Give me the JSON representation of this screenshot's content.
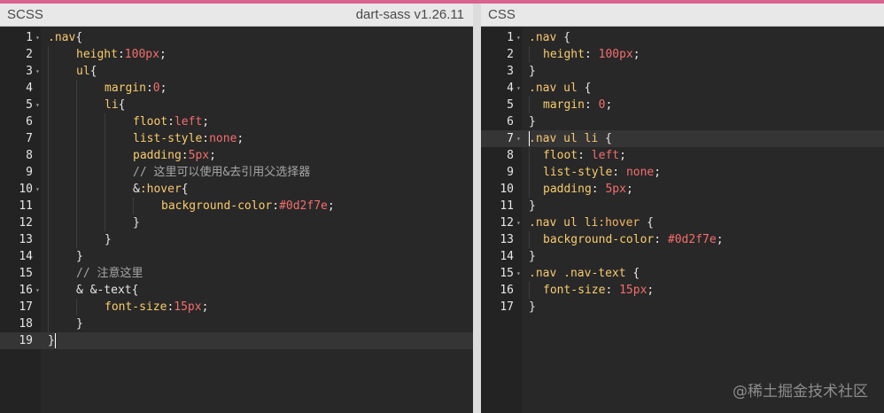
{
  "left_pane": {
    "language": "SCSS",
    "compiler_version": "dart-sass v1.26.11",
    "active_line": 19,
    "lines": [
      {
        "n": "1",
        "fold": true,
        "indent": 0,
        "tokens": [
          [
            ".nav",
            "sel"
          ],
          [
            "{",
            "pun"
          ]
        ]
      },
      {
        "n": "2",
        "fold": false,
        "indent": 1,
        "tokens": [
          [
            "height",
            "prop"
          ],
          [
            ":",
            "pun"
          ],
          [
            "100px",
            "num"
          ],
          [
            ";",
            "pun"
          ]
        ]
      },
      {
        "n": "3",
        "fold": true,
        "indent": 1,
        "tokens": [
          [
            "ul",
            "sel"
          ],
          [
            "{",
            "pun"
          ]
        ]
      },
      {
        "n": "4",
        "fold": false,
        "indent": 2,
        "tokens": [
          [
            "margin",
            "prop"
          ],
          [
            ":",
            "pun"
          ],
          [
            "0",
            "num"
          ],
          [
            ";",
            "pun"
          ]
        ]
      },
      {
        "n": "5",
        "fold": true,
        "indent": 2,
        "tokens": [
          [
            "li",
            "sel"
          ],
          [
            "{",
            "pun"
          ]
        ]
      },
      {
        "n": "6",
        "fold": false,
        "indent": 3,
        "tokens": [
          [
            "floot",
            "prop"
          ],
          [
            ":",
            "pun"
          ],
          [
            "left",
            "val"
          ],
          [
            ";",
            "pun"
          ]
        ]
      },
      {
        "n": "7",
        "fold": false,
        "indent": 3,
        "tokens": [
          [
            "list-style",
            "prop"
          ],
          [
            ":",
            "pun"
          ],
          [
            "none",
            "val"
          ],
          [
            ";",
            "pun"
          ]
        ]
      },
      {
        "n": "8",
        "fold": false,
        "indent": 3,
        "tokens": [
          [
            "padding",
            "prop"
          ],
          [
            ":",
            "pun"
          ],
          [
            "5px",
            "num"
          ],
          [
            ";",
            "pun"
          ]
        ]
      },
      {
        "n": "9",
        "fold": false,
        "indent": 3,
        "tokens": [
          [
            "// 这里可以使用&去引用父选择器",
            "com"
          ]
        ]
      },
      {
        "n": "10",
        "fold": true,
        "indent": 3,
        "tokens": [
          [
            "&",
            "pun"
          ],
          [
            ":hover",
            "sel"
          ],
          [
            "{",
            "pun"
          ]
        ]
      },
      {
        "n": "11",
        "fold": false,
        "indent": 4,
        "tokens": [
          [
            "background-color",
            "prop"
          ],
          [
            ":",
            "pun"
          ],
          [
            "#0d2f7e",
            "num"
          ],
          [
            ";",
            "pun"
          ]
        ]
      },
      {
        "n": "12",
        "fold": false,
        "indent": 3,
        "tokens": [
          [
            "}",
            "pun"
          ]
        ]
      },
      {
        "n": "13",
        "fold": false,
        "indent": 2,
        "tokens": [
          [
            "}",
            "pun"
          ]
        ]
      },
      {
        "n": "14",
        "fold": false,
        "indent": 1,
        "tokens": [
          [
            "}",
            "pun"
          ]
        ]
      },
      {
        "n": "15",
        "fold": false,
        "indent": 1,
        "tokens": [
          [
            "// 注意这里",
            "com"
          ]
        ]
      },
      {
        "n": "16",
        "fold": true,
        "indent": 1,
        "tokens": [
          [
            "& &-text{",
            "pun"
          ]
        ]
      },
      {
        "n": "17",
        "fold": false,
        "indent": 2,
        "tokens": [
          [
            "font-size",
            "prop"
          ],
          [
            ":",
            "pun"
          ],
          [
            "15px",
            "num"
          ],
          [
            ";",
            "pun"
          ]
        ]
      },
      {
        "n": "18",
        "fold": false,
        "indent": 1,
        "tokens": [
          [
            "}",
            "pun"
          ]
        ]
      },
      {
        "n": "19",
        "fold": false,
        "indent": 0,
        "tokens": [
          [
            "}",
            "pun"
          ]
        ]
      }
    ]
  },
  "right_pane": {
    "language": "CSS",
    "active_line": 7,
    "lines": [
      {
        "n": "1",
        "fold": true,
        "indent": 0,
        "tokens": [
          [
            ".nav",
            "sel"
          ],
          [
            " {",
            "pun"
          ]
        ]
      },
      {
        "n": "2",
        "fold": false,
        "indent": 1,
        "tokens": [
          [
            "height",
            "prop"
          ],
          [
            ": ",
            "pun"
          ],
          [
            "100px",
            "num"
          ],
          [
            ";",
            "pun"
          ]
        ]
      },
      {
        "n": "3",
        "fold": false,
        "indent": 0,
        "tokens": [
          [
            "}",
            "pun"
          ]
        ]
      },
      {
        "n": "4",
        "fold": true,
        "indent": 0,
        "tokens": [
          [
            ".nav ul",
            "sel"
          ],
          [
            " {",
            "pun"
          ]
        ]
      },
      {
        "n": "5",
        "fold": false,
        "indent": 1,
        "tokens": [
          [
            "margin",
            "prop"
          ],
          [
            ": ",
            "pun"
          ],
          [
            "0",
            "num"
          ],
          [
            ";",
            "pun"
          ]
        ]
      },
      {
        "n": "6",
        "fold": false,
        "indent": 0,
        "tokens": [
          [
            "}",
            "pun"
          ]
        ]
      },
      {
        "n": "7",
        "fold": true,
        "indent": 0,
        "tokens": [
          [
            ".nav ul li",
            "sel"
          ],
          [
            " {",
            "pun"
          ]
        ]
      },
      {
        "n": "8",
        "fold": false,
        "indent": 1,
        "tokens": [
          [
            "floot",
            "prop"
          ],
          [
            ": ",
            "pun"
          ],
          [
            "left",
            "val"
          ],
          [
            ";",
            "pun"
          ]
        ]
      },
      {
        "n": "9",
        "fold": false,
        "indent": 1,
        "tokens": [
          [
            "list-style",
            "prop"
          ],
          [
            ": ",
            "pun"
          ],
          [
            "none",
            "val"
          ],
          [
            ";",
            "pun"
          ]
        ]
      },
      {
        "n": "10",
        "fold": false,
        "indent": 1,
        "tokens": [
          [
            "padding",
            "prop"
          ],
          [
            ": ",
            "pun"
          ],
          [
            "5px",
            "num"
          ],
          [
            ";",
            "pun"
          ]
        ]
      },
      {
        "n": "11",
        "fold": false,
        "indent": 0,
        "tokens": [
          [
            "}",
            "pun"
          ]
        ]
      },
      {
        "n": "12",
        "fold": true,
        "indent": 0,
        "tokens": [
          [
            ".nav ul li",
            "sel"
          ],
          [
            ":hover",
            "kw"
          ],
          [
            " {",
            "pun"
          ]
        ]
      },
      {
        "n": "13",
        "fold": false,
        "indent": 1,
        "tokens": [
          [
            "background-color",
            "prop"
          ],
          [
            ": ",
            "pun"
          ],
          [
            "#0d2f7e",
            "num"
          ],
          [
            ";",
            "pun"
          ]
        ]
      },
      {
        "n": "14",
        "fold": false,
        "indent": 0,
        "tokens": [
          [
            "}",
            "pun"
          ]
        ]
      },
      {
        "n": "15",
        "fold": true,
        "indent": 0,
        "tokens": [
          [
            ".nav .nav-text",
            "sel"
          ],
          [
            " {",
            "pun"
          ]
        ]
      },
      {
        "n": "16",
        "fold": false,
        "indent": 1,
        "tokens": [
          [
            "font-size",
            "prop"
          ],
          [
            ": ",
            "pun"
          ],
          [
            "15px",
            "num"
          ],
          [
            ";",
            "pun"
          ]
        ]
      },
      {
        "n": "17",
        "fold": false,
        "indent": 0,
        "tokens": [
          [
            "}",
            "pun"
          ]
        ]
      }
    ]
  },
  "watermark": "@稀土掘金技术社区",
  "colors": {
    "top_accent": "#d9628f",
    "editor_bg": "#282828",
    "selector": "#f7c870",
    "property": "#f8cc6c",
    "value": "#f46d6d",
    "comment": "#a6a6a6"
  }
}
